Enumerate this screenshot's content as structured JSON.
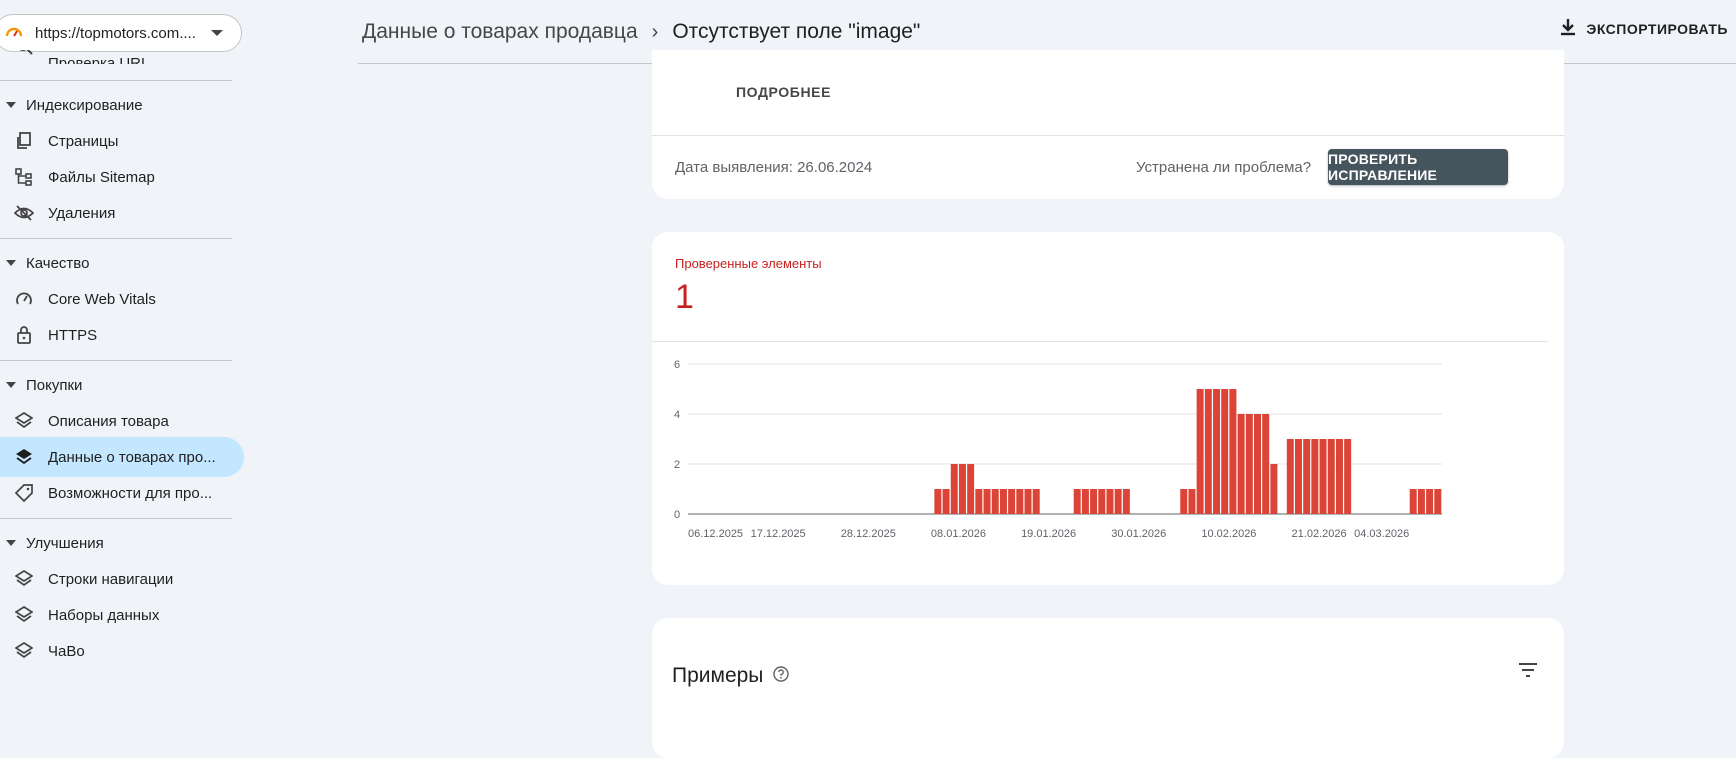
{
  "property": {
    "url": "https://topmotors.com...."
  },
  "sidebar": {
    "partial_item": "Проверка URL",
    "sections": [
      {
        "title": "Индексирование",
        "items": [
          "Страницы",
          "Файлы Sitemap",
          "Удаления"
        ]
      },
      {
        "title": "Качество",
        "items": [
          "Core Web Vitals",
          "HTTPS"
        ]
      },
      {
        "title": "Покупки",
        "items": [
          "Описания товара",
          "Данные о товарах про...",
          "Возможности для про..."
        ]
      },
      {
        "title": "Улучшения",
        "items": [
          "Строки навигации",
          "Наборы данных",
          "ЧаВо"
        ]
      }
    ]
  },
  "header": {
    "crumb_parent": "Данные о товарах продавца",
    "crumb_current": "Отсутствует поле \"image\"",
    "export_label": "ЭКСПОРТИРОВАТЬ"
  },
  "issue_card": {
    "more_label": "ПОДРОБНЕЕ",
    "detected": "Дата выявления: 26.06.2024",
    "fixed_question": "Устранена ли проблема?",
    "verify_label": "ПРОВЕРИТЬ ИСПРАВЛЕНИЕ"
  },
  "metric": {
    "label": "Проверенные элементы",
    "value": "1"
  },
  "examples": {
    "title": "Примеры"
  },
  "colors": {
    "accent": "#c5221f",
    "bar": "#db4437",
    "active_nav": "#c2e7ff"
  },
  "chart_data": {
    "type": "bar",
    "ylim": [
      0,
      6
    ],
    "yticks": [
      0,
      2,
      4,
      6
    ],
    "xtick_labels": [
      "06.12.2025",
      "17.12.2025",
      "28.12.2025",
      "08.01.2026",
      "19.01.2026",
      "30.01.2026",
      "10.02.2026",
      "21.02.2026",
      "04.03.2026"
    ],
    "start_date": "06.12.2025",
    "values": [
      0,
      0,
      0,
      0,
      0,
      0,
      0,
      0,
      0,
      0,
      0,
      0,
      0,
      0,
      0,
      0,
      0,
      0,
      0,
      0,
      0,
      0,
      0,
      0,
      0,
      0,
      0,
      0,
      0,
      0,
      1,
      1,
      2,
      2,
      2,
      1,
      1,
      1,
      1,
      1,
      1,
      1,
      1,
      0,
      0,
      0,
      0,
      1,
      1,
      1,
      1,
      1,
      1,
      1,
      0,
      0,
      0,
      0,
      0,
      0,
      1,
      1,
      5,
      5,
      5,
      5,
      5,
      4,
      4,
      4,
      4,
      2,
      0,
      3,
      3,
      3,
      3,
      3,
      3,
      3,
      3,
      0,
      0,
      0,
      0,
      0,
      0,
      0,
      1,
      1,
      1,
      1
    ]
  }
}
